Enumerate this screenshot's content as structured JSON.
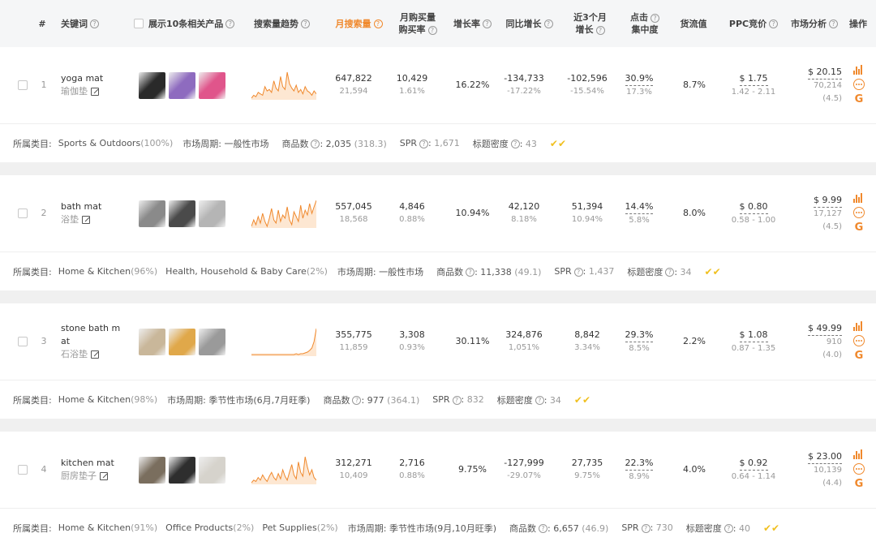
{
  "header": {
    "num": "#",
    "keyword": "关键词",
    "show_products": "展示10条相关产品",
    "trend": "搜索量趋势",
    "monthly_search": "月搜索量",
    "monthly_buy_1": "月购买量",
    "monthly_buy_2": "购买率",
    "growth": "增长率",
    "yoy": "同比增长",
    "recent3_1": "近3个月",
    "recent3_2": "增长",
    "click_1": "点击",
    "click_2": "集中度",
    "flow": "货流值",
    "ppc": "PPC竞价",
    "market": "市场分析",
    "ops": "操作",
    "q": "?"
  },
  "labels": {
    "category": "所属类目:",
    "cycle": "市场周期:",
    "products": "商品数",
    "spr": "SPR",
    "title_density": "标题密度",
    "check": "✔✔"
  },
  "rows": [
    {
      "num": "1",
      "kw": "yoga mat",
      "kw_cn": "瑜伽垫",
      "thumbs": [
        "#2a2a2a",
        "#8e6bbf",
        "#e0558b"
      ],
      "spark": [
        10,
        12,
        11,
        14,
        13,
        12,
        18,
        15,
        16,
        14,
        22,
        17,
        15,
        25,
        18,
        16,
        28,
        20,
        17,
        15,
        19,
        14,
        16,
        13,
        18,
        15,
        14,
        12,
        15,
        13
      ],
      "search": "647,822",
      "search_sub": "21,594",
      "buy": "10,429",
      "buy_sub": "1.61%",
      "growth": "16.22%",
      "yoy": "-134,733",
      "yoy_sub": "-17.22%",
      "r3": "-102,596",
      "r3_sub": "-15.54%",
      "click": "30.9%",
      "click_sub": "17.3%",
      "flow": "8.7%",
      "ppc": "$ 1.75",
      "ppc_sub": "1.42 - 2.11",
      "price": "$ 20.15",
      "m2": "70,214",
      "m3": "(4.5)",
      "cats": [
        {
          "name": "Sports & Outdoors",
          "pct": "(100%)"
        }
      ],
      "cycle": "一般性市场",
      "products": "2,035",
      "products_sub": "(318.3)",
      "spr": "1,671",
      "density": "43"
    },
    {
      "num": "2",
      "kw": "bath mat",
      "kw_cn": "浴垫",
      "thumbs": [
        "#8a8a8a",
        "#4a4a4a",
        "#b5b5b5"
      ],
      "spark": [
        14,
        18,
        15,
        20,
        16,
        22,
        17,
        14,
        19,
        25,
        18,
        16,
        24,
        17,
        21,
        19,
        26,
        18,
        15,
        23,
        20,
        17,
        27,
        19,
        24,
        21,
        28,
        22,
        26,
        30
      ],
      "search": "557,045",
      "search_sub": "18,568",
      "buy": "4,846",
      "buy_sub": "0.88%",
      "growth": "10.94%",
      "yoy": "42,120",
      "yoy_sub": "8.18%",
      "r3": "51,394",
      "r3_sub": "10.94%",
      "click": "14.4%",
      "click_sub": "5.8%",
      "flow": "8.0%",
      "ppc": "$ 0.80",
      "ppc_sub": "0.58 - 1.00",
      "price": "$ 9.99",
      "m2": "17,127",
      "m3": "(4.5)",
      "cats": [
        {
          "name": "Home & Kitchen",
          "pct": "(96%)"
        },
        {
          "name": "Health, Household & Baby Care",
          "pct": "(2%)"
        }
      ],
      "cycle": "一般性市场",
      "products": "11,338",
      "products_sub": "(49.1)",
      "spr": "1,437",
      "density": "34"
    },
    {
      "num": "3",
      "kw": "stone bath mat",
      "kw_cn": "石浴垫",
      "thumbs": [
        "#c9b79a",
        "#e0a84a",
        "#9a9a9a"
      ],
      "spark": [
        2,
        2,
        2,
        2,
        2,
        2,
        2,
        2,
        2,
        2,
        2,
        2,
        2,
        2,
        2,
        2,
        2,
        2,
        2,
        2,
        3,
        2,
        3,
        3,
        4,
        5,
        7,
        10,
        18,
        34
      ],
      "search": "355,775",
      "search_sub": "11,859",
      "buy": "3,308",
      "buy_sub": "0.93%",
      "growth": "30.11%",
      "yoy": "324,876",
      "yoy_sub": "1,051%",
      "r3": "8,842",
      "r3_sub": "3.34%",
      "click": "29.3%",
      "click_sub": "8.5%",
      "flow": "2.2%",
      "ppc": "$ 1.08",
      "ppc_sub": "0.87 - 1.35",
      "price": "$ 49.99",
      "m2": "910",
      "m3": "(4.0)",
      "cats": [
        {
          "name": "Home & Kitchen",
          "pct": "(98%)"
        }
      ],
      "cycle": "季节性市场(6月,7月旺季)",
      "products": "977",
      "products_sub": "(364.1)",
      "spr": "832",
      "density": "34"
    },
    {
      "num": "4",
      "kw": "kitchen mat",
      "kw_cn": "厨房垫子",
      "thumbs": [
        "#7a6e5e",
        "#2e2e2e",
        "#d6d3cc"
      ],
      "spark": [
        10,
        12,
        11,
        14,
        12,
        16,
        13,
        11,
        15,
        18,
        14,
        12,
        17,
        13,
        20,
        15,
        12,
        18,
        24,
        16,
        13,
        26,
        18,
        15,
        30,
        22,
        16,
        20,
        14,
        12
      ],
      "search": "312,271",
      "search_sub": "10,409",
      "buy": "2,716",
      "buy_sub": "0.88%",
      "growth": "9.75%",
      "yoy": "-127,999",
      "yoy_sub": "-29.07%",
      "r3": "27,735",
      "r3_sub": "9.75%",
      "click": "22.3%",
      "click_sub": "8.9%",
      "flow": "4.0%",
      "ppc": "$ 0.92",
      "ppc_sub": "0.64 - 1.14",
      "price": "$ 23.00",
      "m2": "10,139",
      "m3": "(4.4)",
      "cats": [
        {
          "name": "Home & Kitchen",
          "pct": "(91%)"
        },
        {
          "name": "Office Products",
          "pct": "(2%)"
        },
        {
          "name": "Pet Supplies",
          "pct": "(2%)"
        }
      ],
      "cycle": "季节性市场(9月,10月旺季)",
      "products": "6,657",
      "products_sub": "(46.9)",
      "spr": "730",
      "density": "40"
    }
  ],
  "colors": {
    "accent": "#f0892d",
    "check": "#f0c020"
  }
}
